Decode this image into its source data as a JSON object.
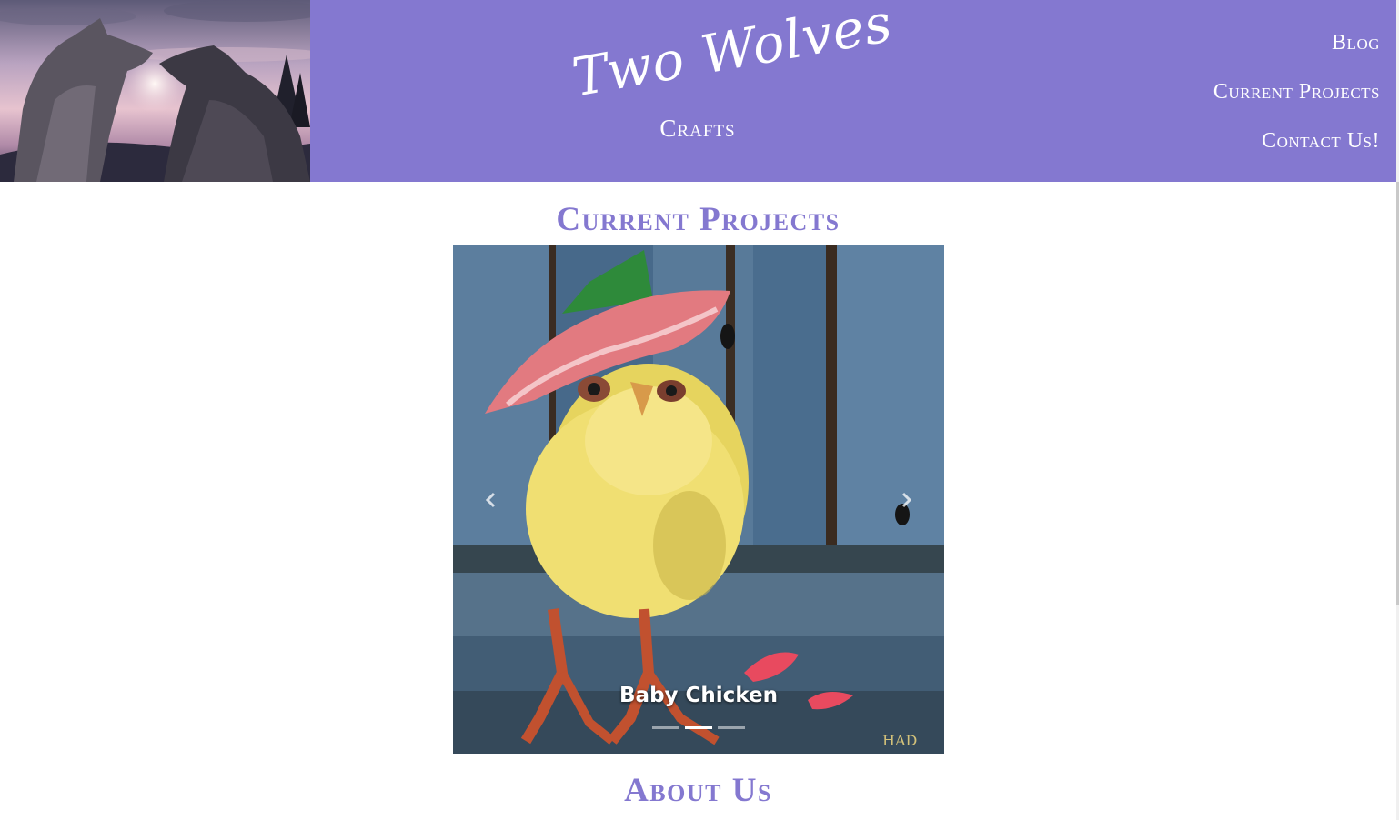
{
  "header": {
    "logo_script": "Two Wolves",
    "logo_sub": "Crafts",
    "background_color": "#8478d0"
  },
  "nav": {
    "items": [
      {
        "label": "Blog"
      },
      {
        "label": "Current Projects"
      },
      {
        "label": "Contact Us!"
      }
    ]
  },
  "sections": {
    "current_projects_title": "Current Projects",
    "about_title": "About Us"
  },
  "carousel": {
    "caption": "Baby Chicken",
    "active_index": 1,
    "indicator_count": 3,
    "prev_icon": "chevron-left-icon",
    "next_icon": "chevron-right-icon"
  },
  "colors": {
    "accent": "#8478d0",
    "text_on_accent": "#ffffff"
  }
}
